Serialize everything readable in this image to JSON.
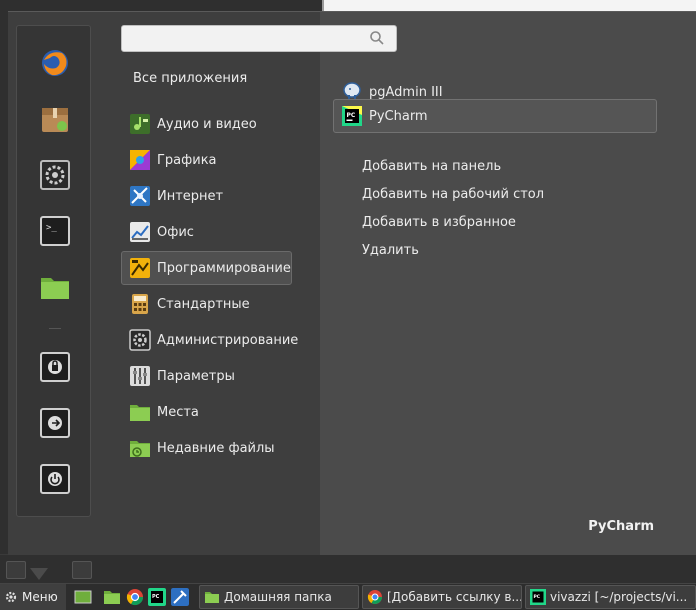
{
  "search": {
    "value": "",
    "placeholder": ""
  },
  "categories": {
    "all_label": "Все приложения",
    "items": [
      {
        "label": "Аудио и видео",
        "icon": "audio-video-icon"
      },
      {
        "label": "Графика",
        "icon": "graphics-icon"
      },
      {
        "label": "Интернет",
        "icon": "internet-icon"
      },
      {
        "label": "Офис",
        "icon": "office-icon"
      },
      {
        "label": "Программирование",
        "icon": "programming-icon",
        "selected": true
      },
      {
        "label": "Стандартные",
        "icon": "accessories-icon"
      },
      {
        "label": "Администрирование",
        "icon": "administration-icon"
      },
      {
        "label": "Параметры",
        "icon": "preferences-icon"
      },
      {
        "label": "Места",
        "icon": "places-folder-icon"
      },
      {
        "label": "Недавние файлы",
        "icon": "recent-files-icon"
      }
    ]
  },
  "apps": {
    "items": [
      {
        "label": "pgAdmin III",
        "icon": "pgadmin-elephant-icon"
      },
      {
        "label": "PyCharm",
        "icon": "pycharm-icon",
        "selected": true
      }
    ],
    "context_actions": [
      "Добавить на панель",
      "Добавить на рабочий стол",
      "Добавить в избранное",
      "Удалить"
    ],
    "selected_name": "PyCharm"
  },
  "favorites": [
    "firefox-icon",
    "package-manager-icon",
    "settings-icon",
    "terminal-icon",
    "folder-icon",
    "lock-screen-icon",
    "logout-icon",
    "shutdown-icon"
  ],
  "taskbar": {
    "menu_label": "Меню",
    "tasks": [
      {
        "label": "Домашняя папка",
        "icon": "folder-icon"
      },
      {
        "label": "[Добавить ссылку в...",
        "icon": "chrome-icon"
      },
      {
        "label": "vivazzi [~/projects/vi...",
        "icon": "pycharm-icon"
      }
    ]
  },
  "colors": {
    "panel_bg": "#4b4b4b",
    "sidebar_bg": "#3e3e3e",
    "taskbar_bg": "#2d2d2d"
  }
}
